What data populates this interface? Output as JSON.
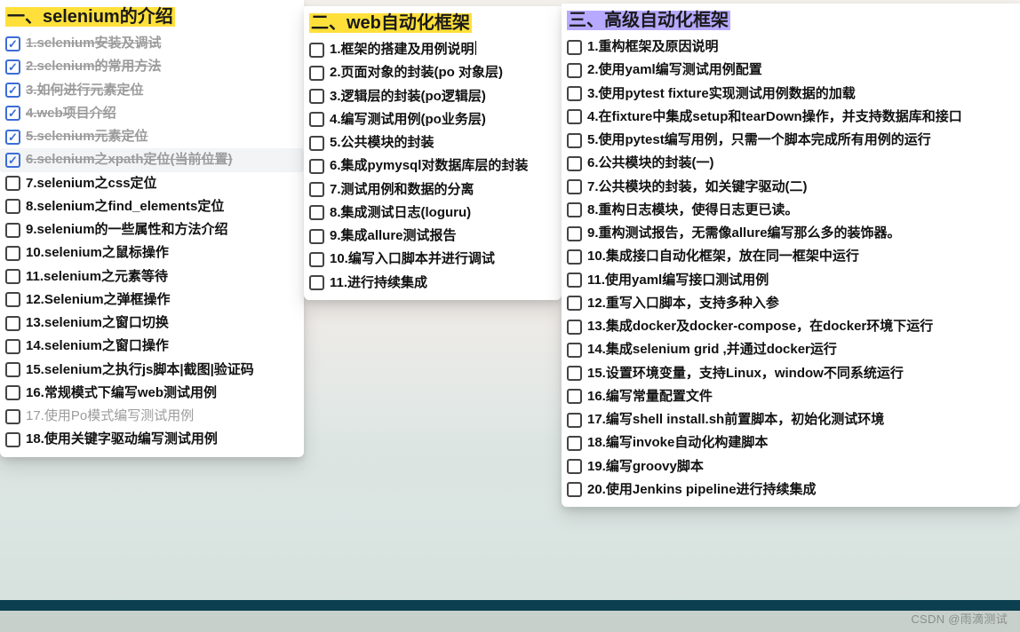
{
  "watermark": "CSDN @雨滴测试",
  "columns": [
    {
      "id": "col1",
      "heading": "一、selenium的介绍",
      "highlight": "yellow",
      "items": [
        {
          "checked": true,
          "done": true,
          "label": "1.selenium安装及调试"
        },
        {
          "checked": true,
          "done": true,
          "label": "2.selenium的常用方法"
        },
        {
          "checked": true,
          "done": true,
          "label": "3.如何进行元素定位"
        },
        {
          "checked": true,
          "done": true,
          "label": "4.web项目介绍"
        },
        {
          "checked": true,
          "done": true,
          "label": "5.selenium元素定位"
        },
        {
          "checked": true,
          "done": true,
          "selected": true,
          "label": "6.selenium之xpath定位(当前位置)"
        },
        {
          "checked": false,
          "done": false,
          "label": "7.selenium之css定位"
        },
        {
          "checked": false,
          "done": false,
          "label": "8.selenium之find_elements定位"
        },
        {
          "checked": false,
          "done": false,
          "label": "9.selenium的一些属性和方法介绍"
        },
        {
          "checked": false,
          "done": false,
          "label": "10.selenium之鼠标操作"
        },
        {
          "checked": false,
          "done": false,
          "label": "11.selenium之元素等待"
        },
        {
          "checked": false,
          "done": false,
          "label": "12.Selenium之弹框操作"
        },
        {
          "checked": false,
          "done": false,
          "label": "13.selenium之窗口切换"
        },
        {
          "checked": false,
          "done": false,
          "label": "14.selenium之窗口操作"
        },
        {
          "checked": false,
          "done": false,
          "label": "15.selenium之执行js脚本|截图|验证码"
        },
        {
          "checked": false,
          "done": false,
          "label": "16.常规模式下编写web测试用例"
        },
        {
          "checked": false,
          "done": false,
          "muted": true,
          "label": "17.使用Po模式编写测试用例"
        },
        {
          "checked": false,
          "done": false,
          "label": "18.使用关键字驱动编写测试用例"
        }
      ]
    },
    {
      "id": "col2",
      "heading": "二、web自动化框架",
      "highlight": "yellow",
      "items": [
        {
          "checked": false,
          "done": false,
          "caret": true,
          "label": "1.框架的搭建及用例说明"
        },
        {
          "checked": false,
          "done": false,
          "label": "2.页面对象的封装(po 对象层)"
        },
        {
          "checked": false,
          "done": false,
          "label": "3.逻辑层的封装(po逻辑层)"
        },
        {
          "checked": false,
          "done": false,
          "label": "4.编写测试用例(po业务层)"
        },
        {
          "checked": false,
          "done": false,
          "label": "5.公共模块的封装"
        },
        {
          "checked": false,
          "done": false,
          "label": "6.集成pymysql对数据库层的封装"
        },
        {
          "checked": false,
          "done": false,
          "label": "7.测试用例和数据的分离"
        },
        {
          "checked": false,
          "done": false,
          "label": "8.集成测试日志(loguru)"
        },
        {
          "checked": false,
          "done": false,
          "label": "9.集成allure测试报告"
        },
        {
          "checked": false,
          "done": false,
          "label": "10.编写入口脚本并进行调试"
        },
        {
          "checked": false,
          "done": false,
          "label": "11.进行持续集成"
        }
      ]
    },
    {
      "id": "col3",
      "heading": "三、高级自动化框架",
      "highlight": "purple",
      "items": [
        {
          "checked": false,
          "done": false,
          "label": "1.重构框架及原因说明"
        },
        {
          "checked": false,
          "done": false,
          "label": "2.使用yaml编写测试用例配置"
        },
        {
          "checked": false,
          "done": false,
          "label": "3.使用pytest fixture实现测试用例数据的加载"
        },
        {
          "checked": false,
          "done": false,
          "label": "4.在fixture中集成setup和tearDown操作，并支持数据库和接口"
        },
        {
          "checked": false,
          "done": false,
          "label": "5.使用pytest编写用例，只需一个脚本完成所有用例的运行"
        },
        {
          "checked": false,
          "done": false,
          "label": "6.公共模块的封装(一)"
        },
        {
          "checked": false,
          "done": false,
          "label": "7.公共模块的封装，如关键字驱动(二)"
        },
        {
          "checked": false,
          "done": false,
          "label": "8.重构日志模块，使得日志更已读。"
        },
        {
          "checked": false,
          "done": false,
          "label": "9.重构测试报告，无需像allure编写那么多的装饰器。"
        },
        {
          "checked": false,
          "done": false,
          "label": "10.集成接口自动化框架，放在同一框架中运行"
        },
        {
          "checked": false,
          "done": false,
          "label": "11.使用yaml编写接口测试用例"
        },
        {
          "checked": false,
          "done": false,
          "label": "12.重写入口脚本，支持多种入参"
        },
        {
          "checked": false,
          "done": false,
          "label": "13.集成docker及docker-compose，在docker环境下运行"
        },
        {
          "checked": false,
          "done": false,
          "label": "14.集成selenium grid ,并通过docker运行"
        },
        {
          "checked": false,
          "done": false,
          "label": "15.设置环境变量，支持Linux，window不同系统运行"
        },
        {
          "checked": false,
          "done": false,
          "label": "16.编写常量配置文件"
        },
        {
          "checked": false,
          "done": false,
          "label": "17.编写shell install.sh前置脚本，初始化测试环境"
        },
        {
          "checked": false,
          "done": false,
          "label": "18.编写invoke自动化构建脚本"
        },
        {
          "checked": false,
          "done": false,
          "label": "19.编写groovy脚本"
        },
        {
          "checked": false,
          "done": false,
          "label": "20.使用Jenkins pipeline进行持续集成"
        }
      ]
    }
  ]
}
